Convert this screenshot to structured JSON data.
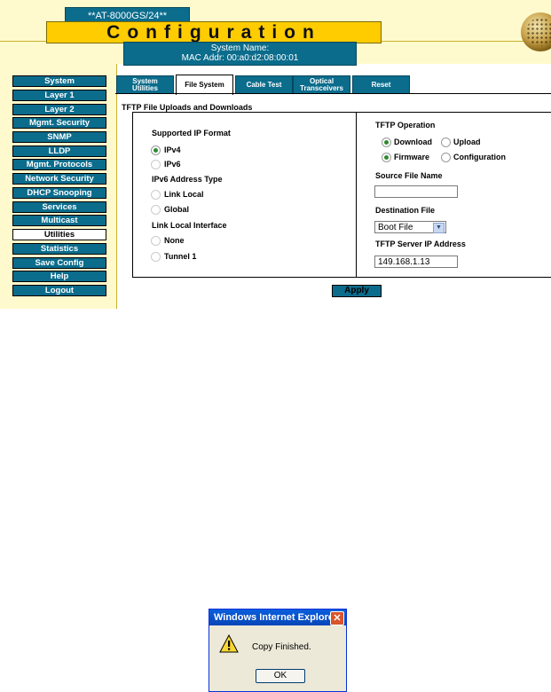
{
  "header": {
    "model": "**AT-8000GS/24**",
    "title": "Configuration",
    "system_name_label": "System Name:",
    "mac_addr": "MAC Addr:  00:a0:d2:08:00:01"
  },
  "nav": {
    "items": [
      {
        "label": "System"
      },
      {
        "label": "Layer 1"
      },
      {
        "label": "Layer 2"
      },
      {
        "label": "Mgmt. Security"
      },
      {
        "label": "SNMP"
      },
      {
        "label": "LLDP"
      },
      {
        "label": "Mgmt. Protocols"
      },
      {
        "label": "Network Security"
      },
      {
        "label": "DHCP Snooping"
      },
      {
        "label": "Services"
      },
      {
        "label": "Multicast"
      },
      {
        "label": "Utilities"
      },
      {
        "label": "Statistics"
      },
      {
        "label": "Save Config"
      },
      {
        "label": "Help"
      },
      {
        "label": "Logout"
      }
    ],
    "active": "Utilities"
  },
  "tabs": [
    {
      "line1": "System",
      "line2": "Utilities"
    },
    {
      "line1": "File System",
      "line2": ""
    },
    {
      "line1": "Cable Test",
      "line2": ""
    },
    {
      "line1": "Optical",
      "line2": "Transceivers"
    },
    {
      "line1": "Reset",
      "line2": ""
    }
  ],
  "active_tab": "File System",
  "section_title": "TFTP File Uploads and Downloads",
  "left_panel": {
    "ip_format_label": "Supported IP Format",
    "ipv4": "IPv4",
    "ipv6": "IPv6",
    "ipv6_addr_type_label": "IPv6 Address Type",
    "link_local": "Link Local",
    "global": "Global",
    "link_local_iface_label": "Link Local Interface",
    "none": "None",
    "tunnel": "Tunnel 1"
  },
  "right_panel": {
    "operation_label": "TFTP Operation",
    "download": "Download",
    "upload": "Upload",
    "firmware": "Firmware",
    "configuration": "Configuration",
    "source_label": "Source File Name",
    "source_value": "",
    "dest_label": "Destination File",
    "dest_value": "Boot File",
    "server_label": "TFTP Server IP Address",
    "server_value": "149.168.1.13"
  },
  "apply_label": "Apply",
  "dialog": {
    "title": "Windows Internet Explorer",
    "message": "Copy Finished.",
    "ok": "OK"
  },
  "colors": {
    "teal": "#0B6C8C",
    "banner_yellow": "#FFCC00",
    "cream": "#FFFACD",
    "radio_green": "#2e8b2e"
  }
}
